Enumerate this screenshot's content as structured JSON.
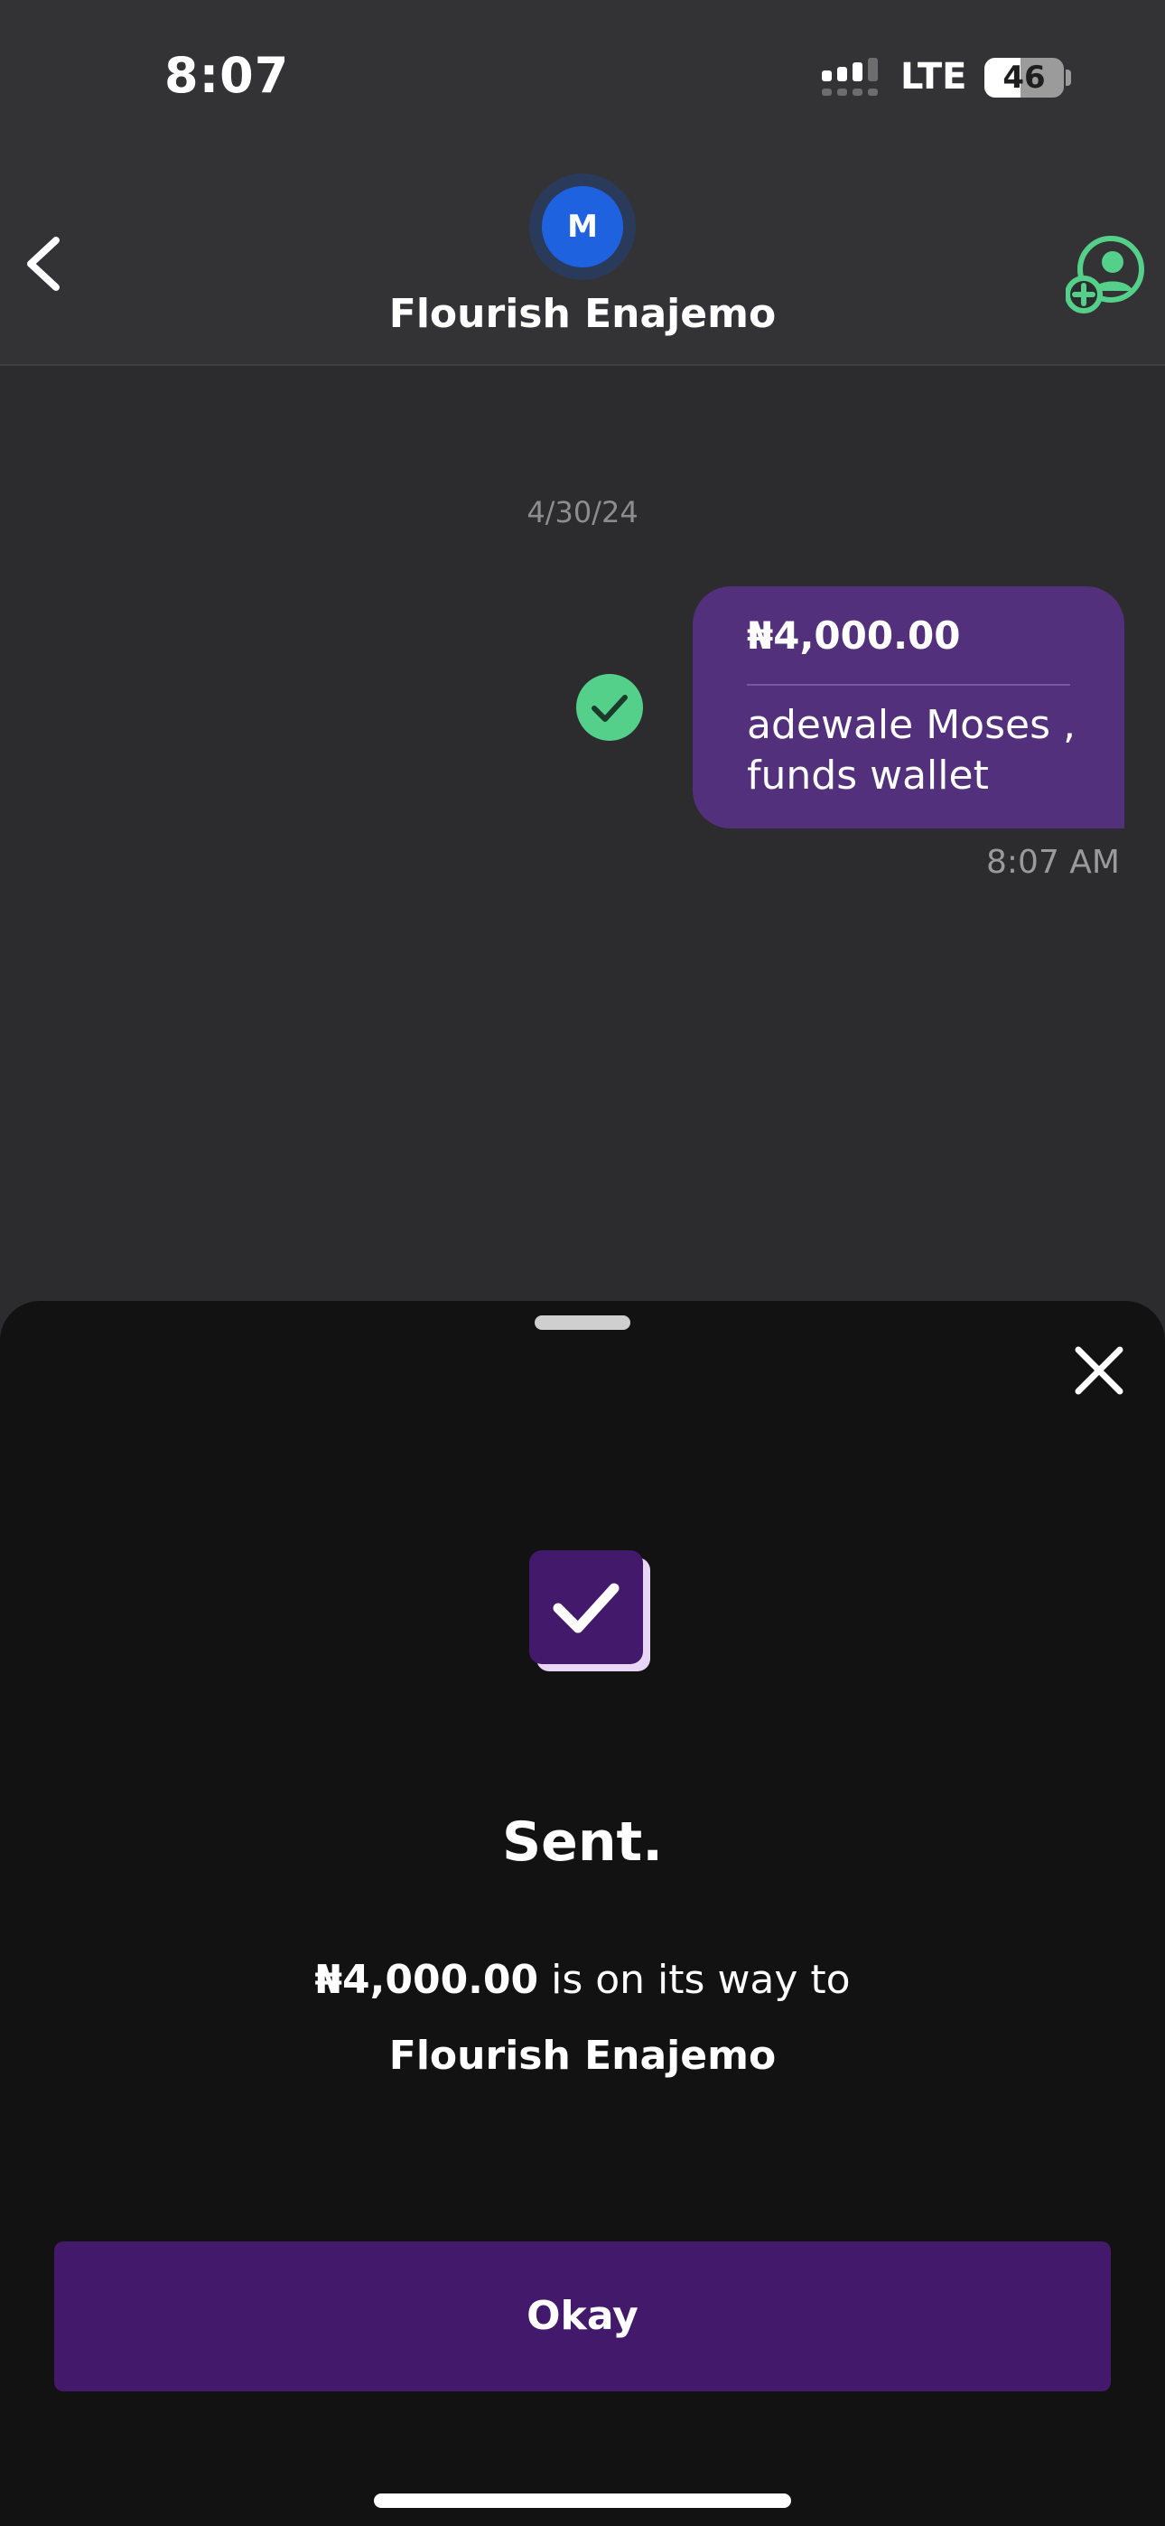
{
  "status_bar": {
    "time": "8:07",
    "network": "LTE",
    "battery": "46",
    "battery_level": 0.46
  },
  "header": {
    "avatar_initial": "M",
    "contact_name": "Flourish Enajemo",
    "icons": {
      "back": "chevron-left-icon",
      "add_contact": "add-contact-icon"
    }
  },
  "conversation": {
    "date": "4/30/24",
    "message": {
      "amount": "₦4,000.00",
      "note": "adewale Moses , funds wallet",
      "time": "8:07 AM",
      "status_icon": "check-circle-icon"
    }
  },
  "sheet": {
    "title": "Sent.",
    "amount": "₦4,000.00",
    "summary_suffix": " is on its way to",
    "recipient": "Flourish Enajemo",
    "okay_label": "Okay",
    "icons": {
      "close": "close-icon",
      "success": "checkbox-checked-icon"
    }
  },
  "colors": {
    "accent_purple": "#43196b",
    "bubble_purple": "#52307c",
    "success_green": "#55d08a",
    "avatar_blue": "#1f62e0"
  }
}
